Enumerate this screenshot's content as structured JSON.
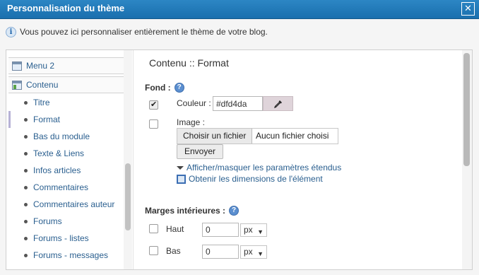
{
  "window": {
    "title": "Personnalisation du thème",
    "close_label": "✕"
  },
  "intro": {
    "text": "Vous pouvez ici personnaliser entièrement le thème de votre blog."
  },
  "sidebar": {
    "items": [
      {
        "label": "Menu 2"
      },
      {
        "label": "Contenu"
      },
      {
        "label": "Titre"
      },
      {
        "label": "Format"
      },
      {
        "label": "Bas du module"
      },
      {
        "label": "Texte & Liens"
      },
      {
        "label": "Infos articles"
      },
      {
        "label": "Commentaires"
      },
      {
        "label": "Commentaires auteur"
      },
      {
        "label": "Forums"
      },
      {
        "label": "Forums - listes"
      },
      {
        "label": "Forums - messages"
      }
    ],
    "active_item": "Format"
  },
  "content": {
    "title": "Contenu :: Format",
    "fond": {
      "heading": "Fond :",
      "color_checked": true,
      "color_label": "Couleur :",
      "color_value": "#dfd4da",
      "image_checked": false,
      "image_label": "Image :",
      "choose_file_label": "Choisir un fichier",
      "file_status": "Aucun fichier choisi",
      "send_label": "Envoyer",
      "toggle_link": "Afficher/masquer les paramètres étendus",
      "dims_link": "Obtenir les dimensions de l'élément"
    },
    "margins": {
      "heading": "Marges intérieures :",
      "rows": [
        {
          "label": "Haut",
          "value": "0",
          "unit": "px",
          "checked": false
        },
        {
          "label": "Bas",
          "value": "0",
          "unit": "px",
          "checked": false
        }
      ]
    }
  },
  "colors": {
    "titlebar": "#1a6fae",
    "swatch": "#dfd4da",
    "link": "#2a5f8f"
  }
}
